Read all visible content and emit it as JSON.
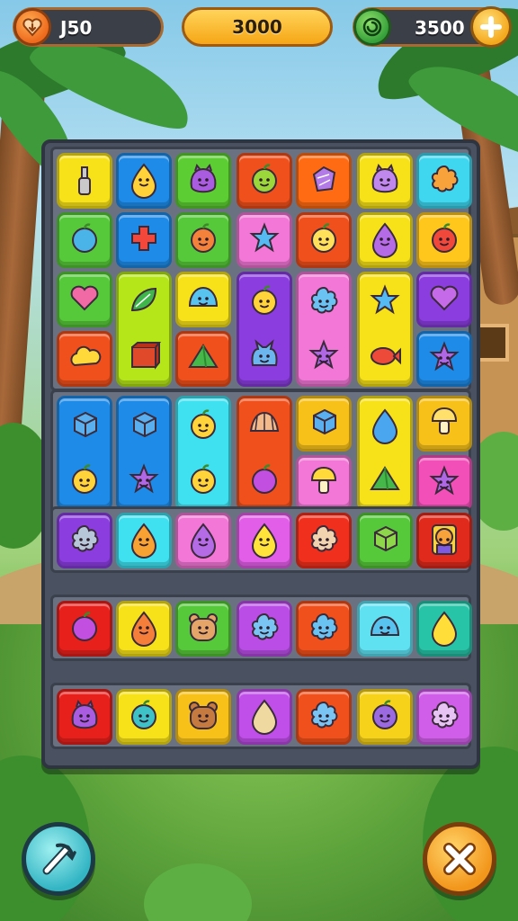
{
  "hud": {
    "lives": {
      "value": "J50",
      "icon": "heart-down-icon"
    },
    "score": {
      "value": "3000"
    },
    "coins": {
      "value": "3500",
      "icon": "green-swirl-coin-icon",
      "add_icon": "plus-icon"
    }
  },
  "board": {
    "sections": [
      {
        "name": "section-1",
        "tiles": [
          {
            "row": 0,
            "col": 0,
            "span": 1,
            "color": "#f7e21a",
            "icon": "bottle"
          },
          {
            "row": 0,
            "col": 1,
            "span": 1,
            "color": "#1e8be8",
            "icon": "smiley-drop"
          },
          {
            "row": 0,
            "col": 2,
            "span": 1,
            "color": "#5ccd32",
            "icon": "purple-monster"
          },
          {
            "row": 0,
            "col": 3,
            "span": 1,
            "color": "#f0501c",
            "icon": "green-berry"
          },
          {
            "row": 0,
            "col": 4,
            "span": 1,
            "color": "#ff6b12",
            "icon": "purple-gem"
          },
          {
            "row": 0,
            "col": 5,
            "span": 1,
            "color": "#f7e21a",
            "icon": "purple-blob"
          },
          {
            "row": 0,
            "col": 6,
            "span": 1,
            "color": "#3fd6ef",
            "icon": "orange-flower"
          },
          {
            "row": 1,
            "col": 0,
            "span": 1,
            "color": "#56c93a",
            "icon": "blue-candy"
          },
          {
            "row": 1,
            "col": 1,
            "span": 1,
            "color": "#1e8be8",
            "icon": "red-cross"
          },
          {
            "row": 1,
            "col": 2,
            "span": 1,
            "color": "#56c93a",
            "icon": "pumpkin"
          },
          {
            "row": 1,
            "col": 3,
            "span": 1,
            "color": "#f277d6",
            "icon": "blue-star"
          },
          {
            "row": 1,
            "col": 4,
            "span": 1,
            "color": "#f0501c",
            "icon": "smiley-lemon"
          },
          {
            "row": 1,
            "col": 5,
            "span": 1,
            "color": "#f7e21a",
            "icon": "purple-drop"
          },
          {
            "row": 1,
            "col": 6,
            "span": 1,
            "color": "#ffc61c",
            "icon": "red-tomato"
          },
          {
            "row": 2,
            "col": 0,
            "span": 1,
            "color": "#56c93a",
            "icon": "pink-heart"
          },
          {
            "row": 3,
            "col": 0,
            "span": 1,
            "color": "#f0501c",
            "icon": "yellow-cloud"
          },
          {
            "row": 2,
            "col": 1,
            "span": 2,
            "color": "#b5e61a",
            "icon": "green-leaf,red-box"
          },
          {
            "row": 2,
            "col": 2,
            "span": 1,
            "color": "#f7e21a",
            "icon": "blue-slime"
          },
          {
            "row": 3,
            "col": 2,
            "span": 1,
            "color": "#f0501c",
            "icon": "green-pyramid"
          },
          {
            "row": 2,
            "col": 3,
            "span": 2,
            "color": "#8b3de0",
            "icon": "yellow-smile,blue-cat"
          },
          {
            "row": 2,
            "col": 4,
            "span": 2,
            "color": "#f277d6",
            "icon": "blue-flower,purple-star"
          },
          {
            "row": 2,
            "col": 5,
            "span": 2,
            "color": "#f7e21a",
            "icon": "blue-star,red-fish"
          },
          {
            "row": 2,
            "col": 6,
            "span": 1,
            "color": "#8b3de0",
            "icon": "purple-heart"
          },
          {
            "row": 3,
            "col": 6,
            "span": 1,
            "color": "#1e8be8",
            "icon": "purple-star"
          }
        ]
      },
      {
        "name": "section-2",
        "tiles": [
          {
            "row": 0,
            "col": 0,
            "span": 2,
            "color": "#1e8be8",
            "icon": "blue-cube,yellow-smile"
          },
          {
            "row": 0,
            "col": 1,
            "span": 2,
            "color": "#1e8be8",
            "icon": "blue-cube,purple-star"
          },
          {
            "row": 0,
            "col": 2,
            "span": 2,
            "color": "#3fe1f0",
            "icon": "yellow-smile,yellow-smile"
          },
          {
            "row": 0,
            "col": 3,
            "span": 2,
            "color": "#f0501c",
            "icon": "shell,purple-ball"
          },
          {
            "row": 0,
            "col": 4,
            "span": 1,
            "color": "#f7c11a",
            "icon": "blue-cube"
          },
          {
            "row": 1,
            "col": 4,
            "span": 1,
            "color": "#f277d6",
            "icon": "yellow-mushroom"
          },
          {
            "row": 0,
            "col": 5,
            "span": 2,
            "color": "#f7e21a",
            "icon": "blue-egg,green-pyramid"
          },
          {
            "row": 0,
            "col": 6,
            "span": 1,
            "color": "#f7c11a",
            "icon": "yellow-bulb"
          },
          {
            "row": 1,
            "col": 6,
            "span": 1,
            "color": "#f24fb8",
            "icon": "purple-star"
          }
        ]
      },
      {
        "name": "section-3",
        "tiles": [
          {
            "row": 0,
            "col": 0,
            "span": 1,
            "color": "#8b3de0",
            "icon": "grey-ghost"
          },
          {
            "row": 0,
            "col": 1,
            "span": 1,
            "color": "#3fe1f0",
            "icon": "orange-mango"
          },
          {
            "row": 0,
            "col": 2,
            "span": 1,
            "color": "#f277d6",
            "icon": "purple-drop"
          },
          {
            "row": 0,
            "col": 3,
            "span": 1,
            "color": "#e25ee8",
            "icon": "yellow-pear"
          },
          {
            "row": 0,
            "col": 4,
            "span": 1,
            "color": "#f0301c",
            "icon": "cream-cloud"
          },
          {
            "row": 0,
            "col": 5,
            "span": 1,
            "color": "#56c93a",
            "icon": "green-cube"
          },
          {
            "row": 0,
            "col": 6,
            "span": 1,
            "color": "#e02a1c",
            "icon": "orange-character"
          }
        ]
      },
      {
        "name": "section-4",
        "tiles": [
          {
            "row": 0,
            "col": 0,
            "span": 1,
            "color": "#e8201c",
            "icon": "purple-ball"
          },
          {
            "row": 0,
            "col": 1,
            "span": 1,
            "color": "#f7e21a",
            "icon": "orange-peach"
          },
          {
            "row": 0,
            "col": 2,
            "span": 1,
            "color": "#56c93a",
            "icon": "bear"
          },
          {
            "row": 0,
            "col": 3,
            "span": 1,
            "color": "#b94de6",
            "icon": "blue-ghost"
          },
          {
            "row": 0,
            "col": 4,
            "span": 1,
            "color": "#f0501c",
            "icon": "blue-flower"
          },
          {
            "row": 0,
            "col": 5,
            "span": 1,
            "color": "#5fe1f2",
            "icon": "blue-slime"
          },
          {
            "row": 0,
            "col": 6,
            "span": 1,
            "color": "#27c4a8",
            "icon": "yellow-lemon"
          }
        ]
      },
      {
        "name": "section-5",
        "tiles": [
          {
            "row": 0,
            "col": 0,
            "span": 1,
            "color": "#e8201c",
            "icon": "purple-monster"
          },
          {
            "row": 0,
            "col": 1,
            "span": 1,
            "color": "#f7e21a",
            "icon": "teal-fruit"
          },
          {
            "row": 0,
            "col": 2,
            "span": 1,
            "color": "#f7c11a",
            "icon": "brown-bear"
          },
          {
            "row": 0,
            "col": 3,
            "span": 1,
            "color": "#c04ee8",
            "icon": "cream-potato"
          },
          {
            "row": 0,
            "col": 4,
            "span": 1,
            "color": "#f0501c",
            "icon": "blue-ghost"
          },
          {
            "row": 0,
            "col": 5,
            "span": 1,
            "color": "#f7d21a",
            "icon": "purple-plum"
          },
          {
            "row": 0,
            "col": 6,
            "span": 1,
            "color": "#d05ee8",
            "icon": "lilac-ghost"
          }
        ]
      }
    ]
  },
  "buttons": {
    "shuffle": {
      "icon": "shuffle-wand-icon"
    },
    "close": {
      "icon": "close-x-icon"
    }
  }
}
